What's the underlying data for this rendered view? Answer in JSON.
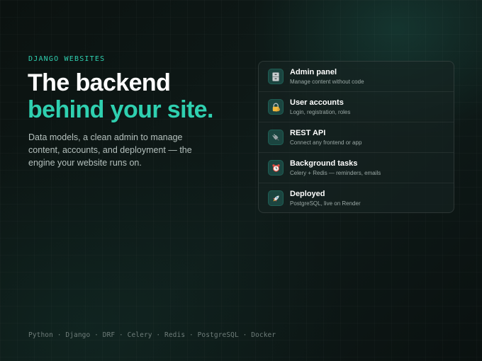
{
  "eyebrow": "DJANGO WEBSITES",
  "headline": {
    "line1": "The backend",
    "line2": "behind your site."
  },
  "description": "Data models, a clean admin to manage content, accounts, and deployment — the engine your website runs on.",
  "features": [
    {
      "title": "Admin panel",
      "subtitle": "Manage content without code",
      "icon": "cabinet-icon"
    },
    {
      "title": "User accounts",
      "subtitle": "Login, registration, roles",
      "icon": "lock-key-icon"
    },
    {
      "title": "REST API",
      "subtitle": "Connect any frontend or app",
      "icon": "plug-icon"
    },
    {
      "title": "Background tasks",
      "subtitle": "Celery + Redis — reminders, emails",
      "icon": "alarm-clock-icon"
    },
    {
      "title": "Deployed",
      "subtitle": "PostgreSQL, live on Render",
      "icon": "rocket-icon"
    }
  ],
  "stack": "Python · Django · DRF · Celery · Redis · PostgreSQL · Docker",
  "colors": {
    "accent": "#2fd0b0",
    "background": "#0c1513",
    "card": "#162422",
    "text_primary": "#ffffff",
    "text_secondary": "#b4c0bd"
  }
}
